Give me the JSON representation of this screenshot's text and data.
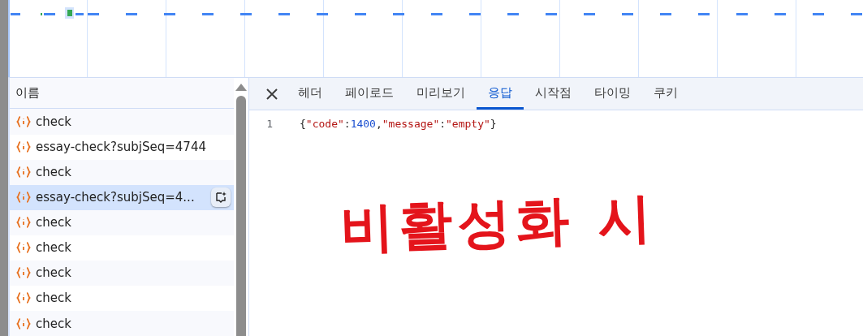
{
  "requests": {
    "header": "이름",
    "rows": [
      {
        "name": "check",
        "selected": false
      },
      {
        "name": "essay-check?subjSeq=4744",
        "selected": false
      },
      {
        "name": "check",
        "selected": false
      },
      {
        "name": "essay-check?subjSeq=4...",
        "selected": true
      },
      {
        "name": "check",
        "selected": false
      },
      {
        "name": "check",
        "selected": false
      },
      {
        "name": "check",
        "selected": false
      },
      {
        "name": "check",
        "selected": false
      },
      {
        "name": "check",
        "selected": false
      }
    ]
  },
  "detail": {
    "tabs": [
      {
        "label": "헤더",
        "selected": false
      },
      {
        "label": "페이로드",
        "selected": false
      },
      {
        "label": "미리보기",
        "selected": false
      },
      {
        "label": "응답",
        "selected": true
      },
      {
        "label": "시작점",
        "selected": false
      },
      {
        "label": "타이밍",
        "selected": false
      },
      {
        "label": "쿠키",
        "selected": false
      }
    ],
    "response": {
      "line_number": "1",
      "tokens": [
        {
          "kind": "punct",
          "text": "{"
        },
        {
          "kind": "string",
          "text": "\"code\""
        },
        {
          "kind": "punct",
          "text": ":"
        },
        {
          "kind": "number",
          "text": "1400"
        },
        {
          "kind": "punct",
          "text": ","
        },
        {
          "kind": "string",
          "text": "\"message\""
        },
        {
          "kind": "punct",
          "text": ":"
        },
        {
          "kind": "string",
          "text": "\"empty\""
        },
        {
          "kind": "punct",
          "text": "}"
        }
      ]
    },
    "annotation": "비활성화 시"
  }
}
